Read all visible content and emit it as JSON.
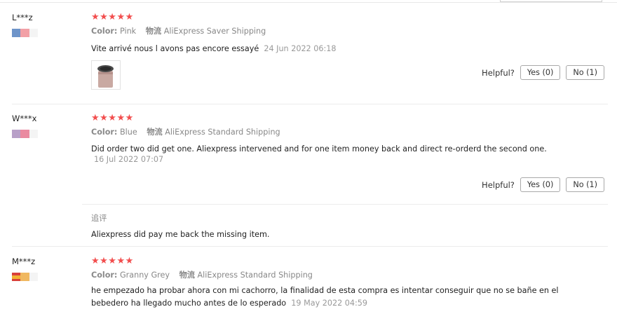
{
  "reviews": [
    {
      "user": "L***z",
      "stars": "★★★★★",
      "color_label": "Color:",
      "color_value": "Pink",
      "shipping_label": "物流",
      "shipping_value": "AliExpress Saver Shipping",
      "text": "Vite arrivé nous l avons pas encore essayé",
      "date": "24 Jun 2022 06:18",
      "helpful_label": "Helpful?",
      "yes_label": "Yes (0)",
      "no_label": "No (1)"
    },
    {
      "user": "W***x",
      "stars": "★★★★★",
      "color_label": "Color:",
      "color_value": "Blue",
      "shipping_label": "物流",
      "shipping_value": "AliExpress Standard Shipping",
      "text": "Did order two did get one. Aliexpress intervened and for one item money back and direct re-orderd the second one.",
      "date": "16 Jul 2022 07:07",
      "helpful_label": "Helpful?",
      "yes_label": "Yes (0)",
      "no_label": "No (1)",
      "additional_title": "追评",
      "additional_text": "Aliexpress did pay me back the missing item."
    },
    {
      "user": "M***z",
      "stars": "★★★★★",
      "color_label": "Color:",
      "color_value": "Granny Grey",
      "shipping_label": "物流",
      "shipping_value": "AliExpress Standard Shipping",
      "text_line1": "he empezado ha probar ahora con mi cachorro, la finalidad de esta compra es intentar conseguir que no se bañe en el",
      "text_line2": "bebedero ha llegado mucho antes de lo esperado",
      "date": "19 May 2022 04:59"
    }
  ],
  "colors": {
    "star": "#f24e4e",
    "muted": "#888888",
    "border": "#a9a9a9"
  }
}
